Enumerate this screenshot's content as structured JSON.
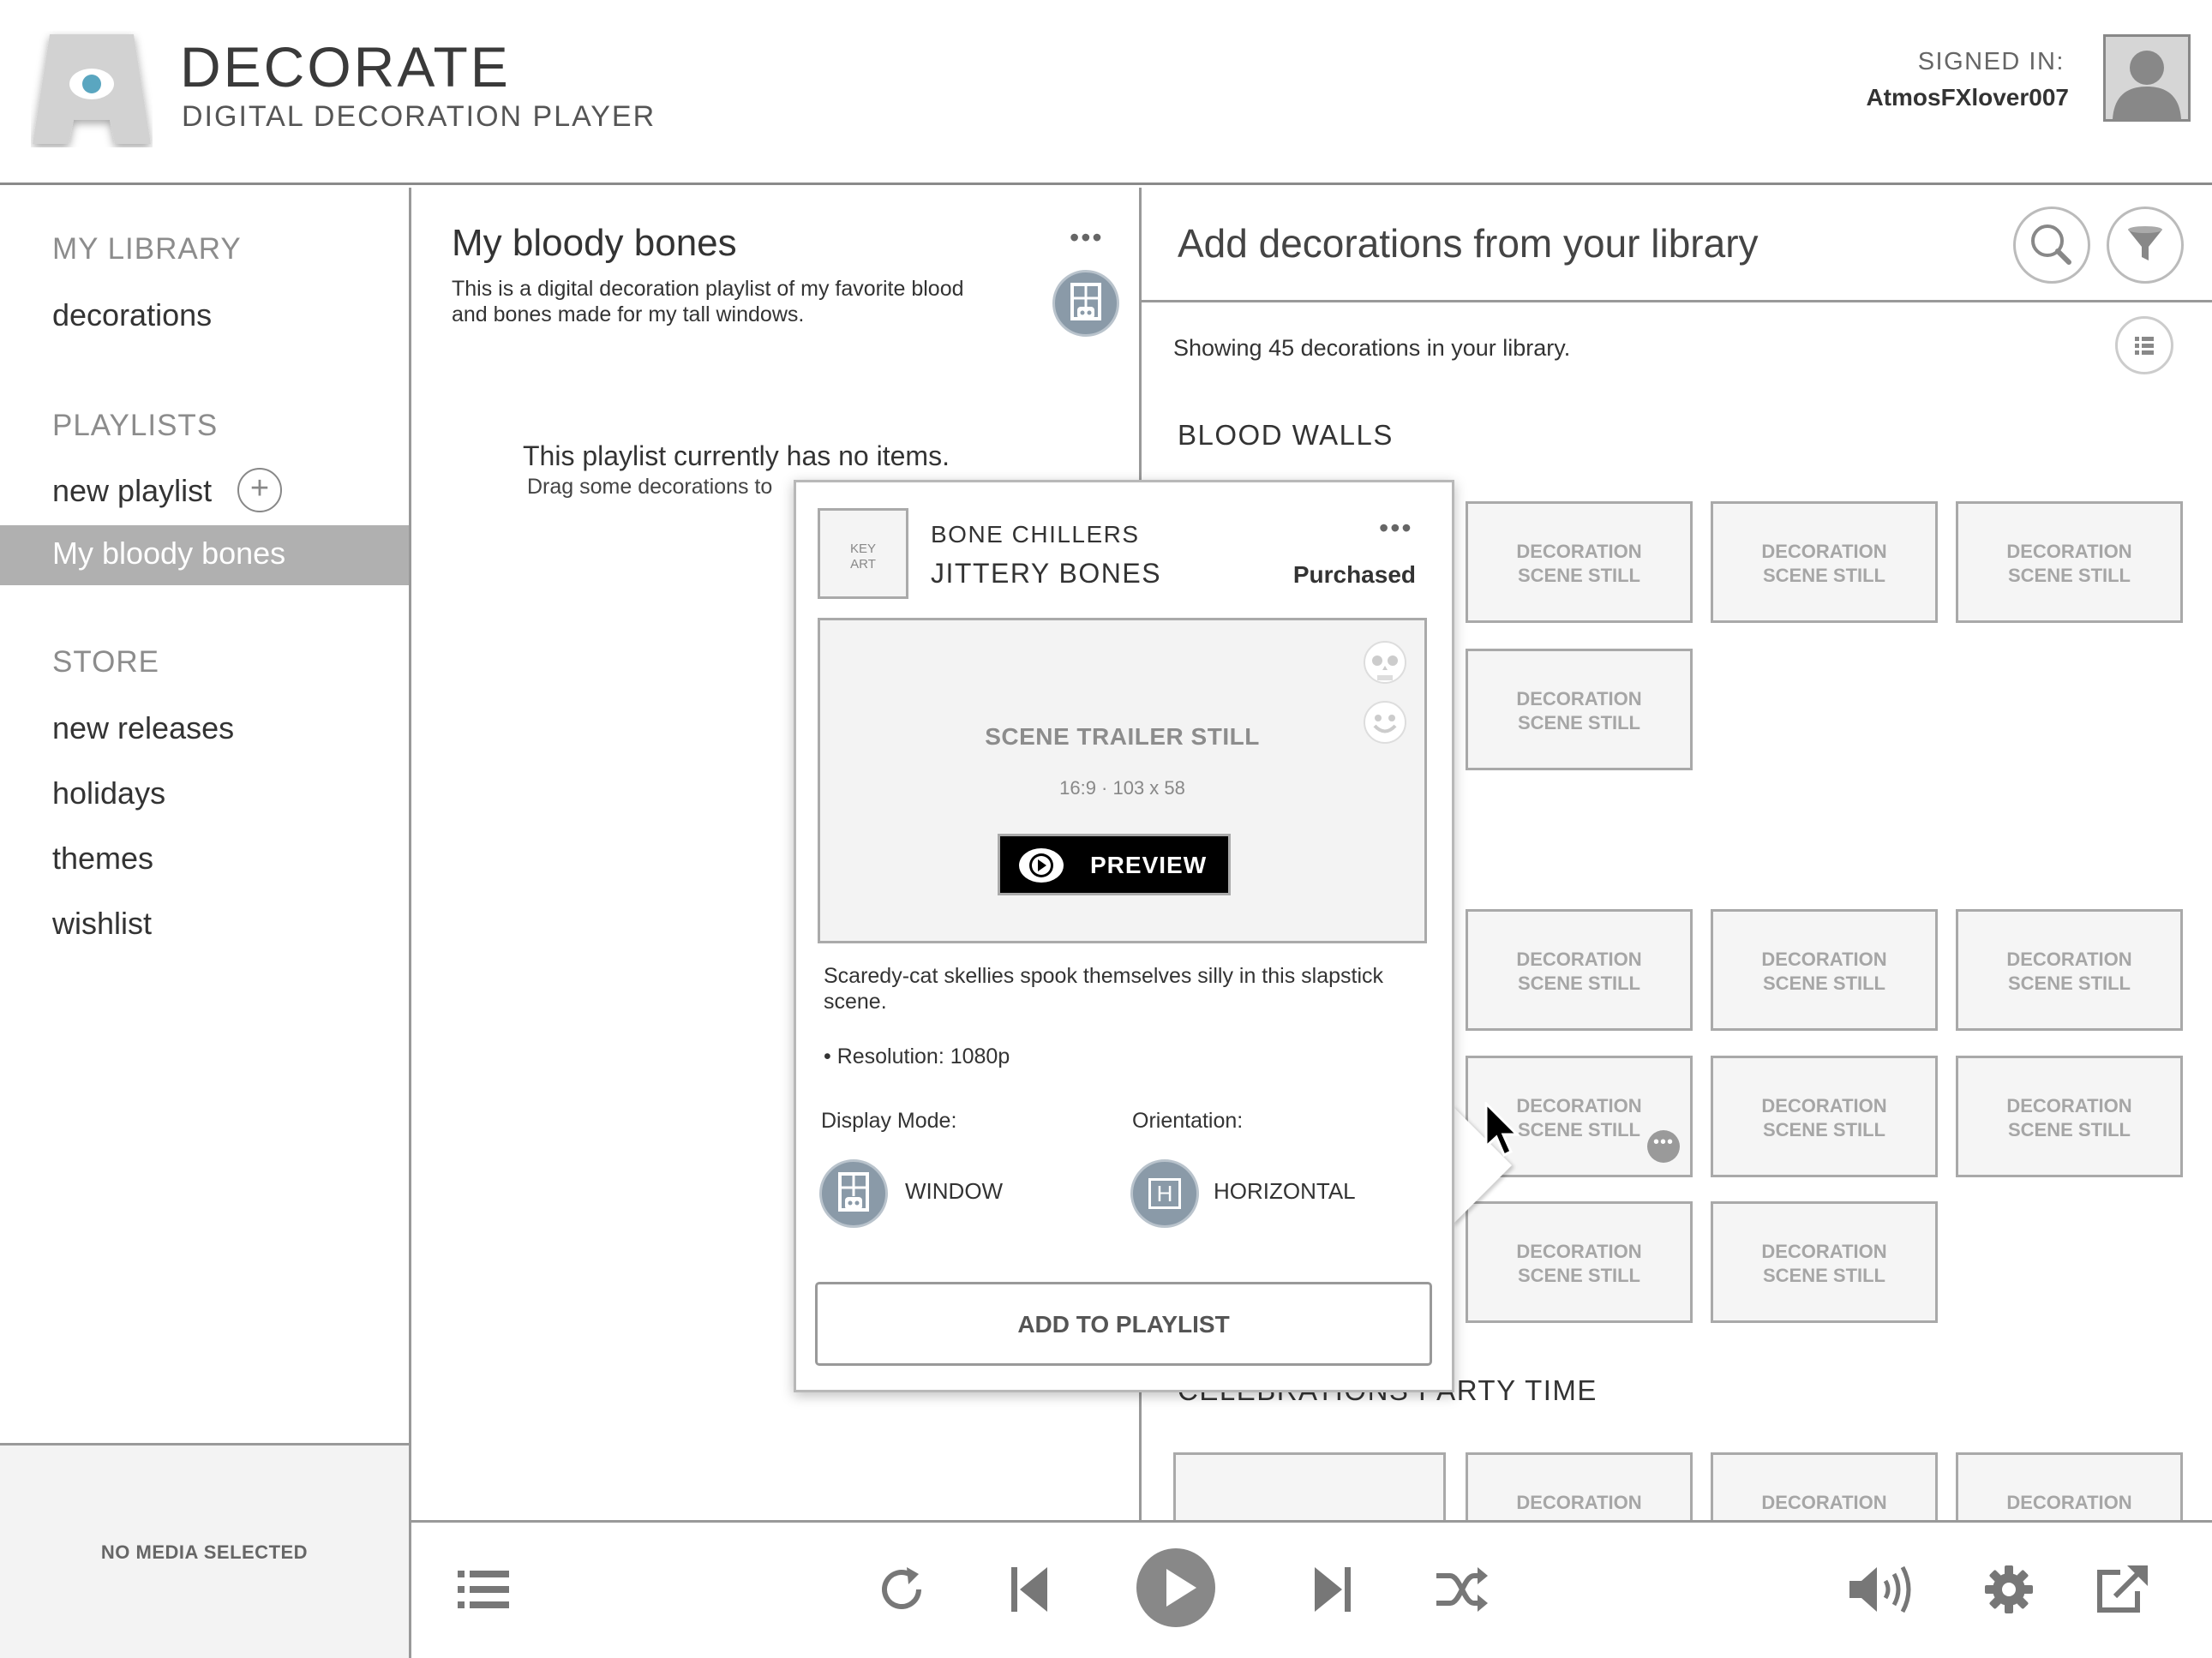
{
  "header": {
    "app_title": "DECORATE",
    "app_subtitle": "DIGITAL DECORATION PLAYER",
    "signed_in_label": "SIGNED IN:",
    "username": "AtmosFXlover007"
  },
  "sidebar": {
    "library_header": "MY LIBRARY",
    "library_items": [
      {
        "label": "decorations"
      }
    ],
    "playlists_header": "PLAYLISTS",
    "new_playlist_label": "new playlist",
    "add_icon_glyph": "+",
    "active_playlist": "My bloody bones",
    "store_header": "STORE",
    "store_items": [
      {
        "label": "new releases"
      },
      {
        "label": "holidays"
      },
      {
        "label": "themes"
      },
      {
        "label": "wishlist"
      }
    ],
    "now_playing": "NO MEDIA SELECTED"
  },
  "playlist": {
    "title": "My bloody bones",
    "description": "This is a digital decoration playlist of my favorite blood and bones made for my tall windows.",
    "more_glyph": "•••",
    "empty_title": "This playlist currently has no items.",
    "empty_subtitle": "Drag some decorations to"
  },
  "library": {
    "title": "Add decorations from your library",
    "count_text": "Showing 45 decorations in your library.",
    "groups": [
      {
        "title": "BLOOD WALLS"
      },
      {
        "title": "CELEBRATIONS PARTY TIME"
      }
    ],
    "tile_label_line1": "DECORATION",
    "tile_label_line2": "SCENE STILL",
    "tile_more_glyph": "•••"
  },
  "popover": {
    "key_art_line1": "KEY",
    "key_art_line2": "ART",
    "series": "BONE CHILLERS",
    "title": "JITTERY BONES",
    "status": "Purchased",
    "more_glyph": "•••",
    "trailer_label": "SCENE TRAILER STILL",
    "trailer_meta": "16:9  ·  103 x 58",
    "preview_label": "PREVIEW",
    "description": "Scaredy-cat skellies spook themselves silly in this slapstick scene.",
    "resolution": "•  Resolution:  1080p",
    "display_mode_label": "Display Mode:",
    "display_mode_value": "WINDOW",
    "orientation_label": "Orientation:",
    "orientation_value": "HORIZONTAL",
    "orientation_glyph": "H",
    "add_button": "ADD TO PLAYLIST"
  },
  "player": {
    "icons": [
      "list-icon",
      "repeat-icon",
      "previous-icon",
      "play-icon",
      "next-icon",
      "shuffle-icon",
      "volume-icon",
      "settings-icon",
      "external-link-icon"
    ]
  },
  "colors": {
    "accent_eye": "#5aa6c0",
    "mode_icon": "#8a9aa8",
    "active_item": "#b0b0b0"
  }
}
